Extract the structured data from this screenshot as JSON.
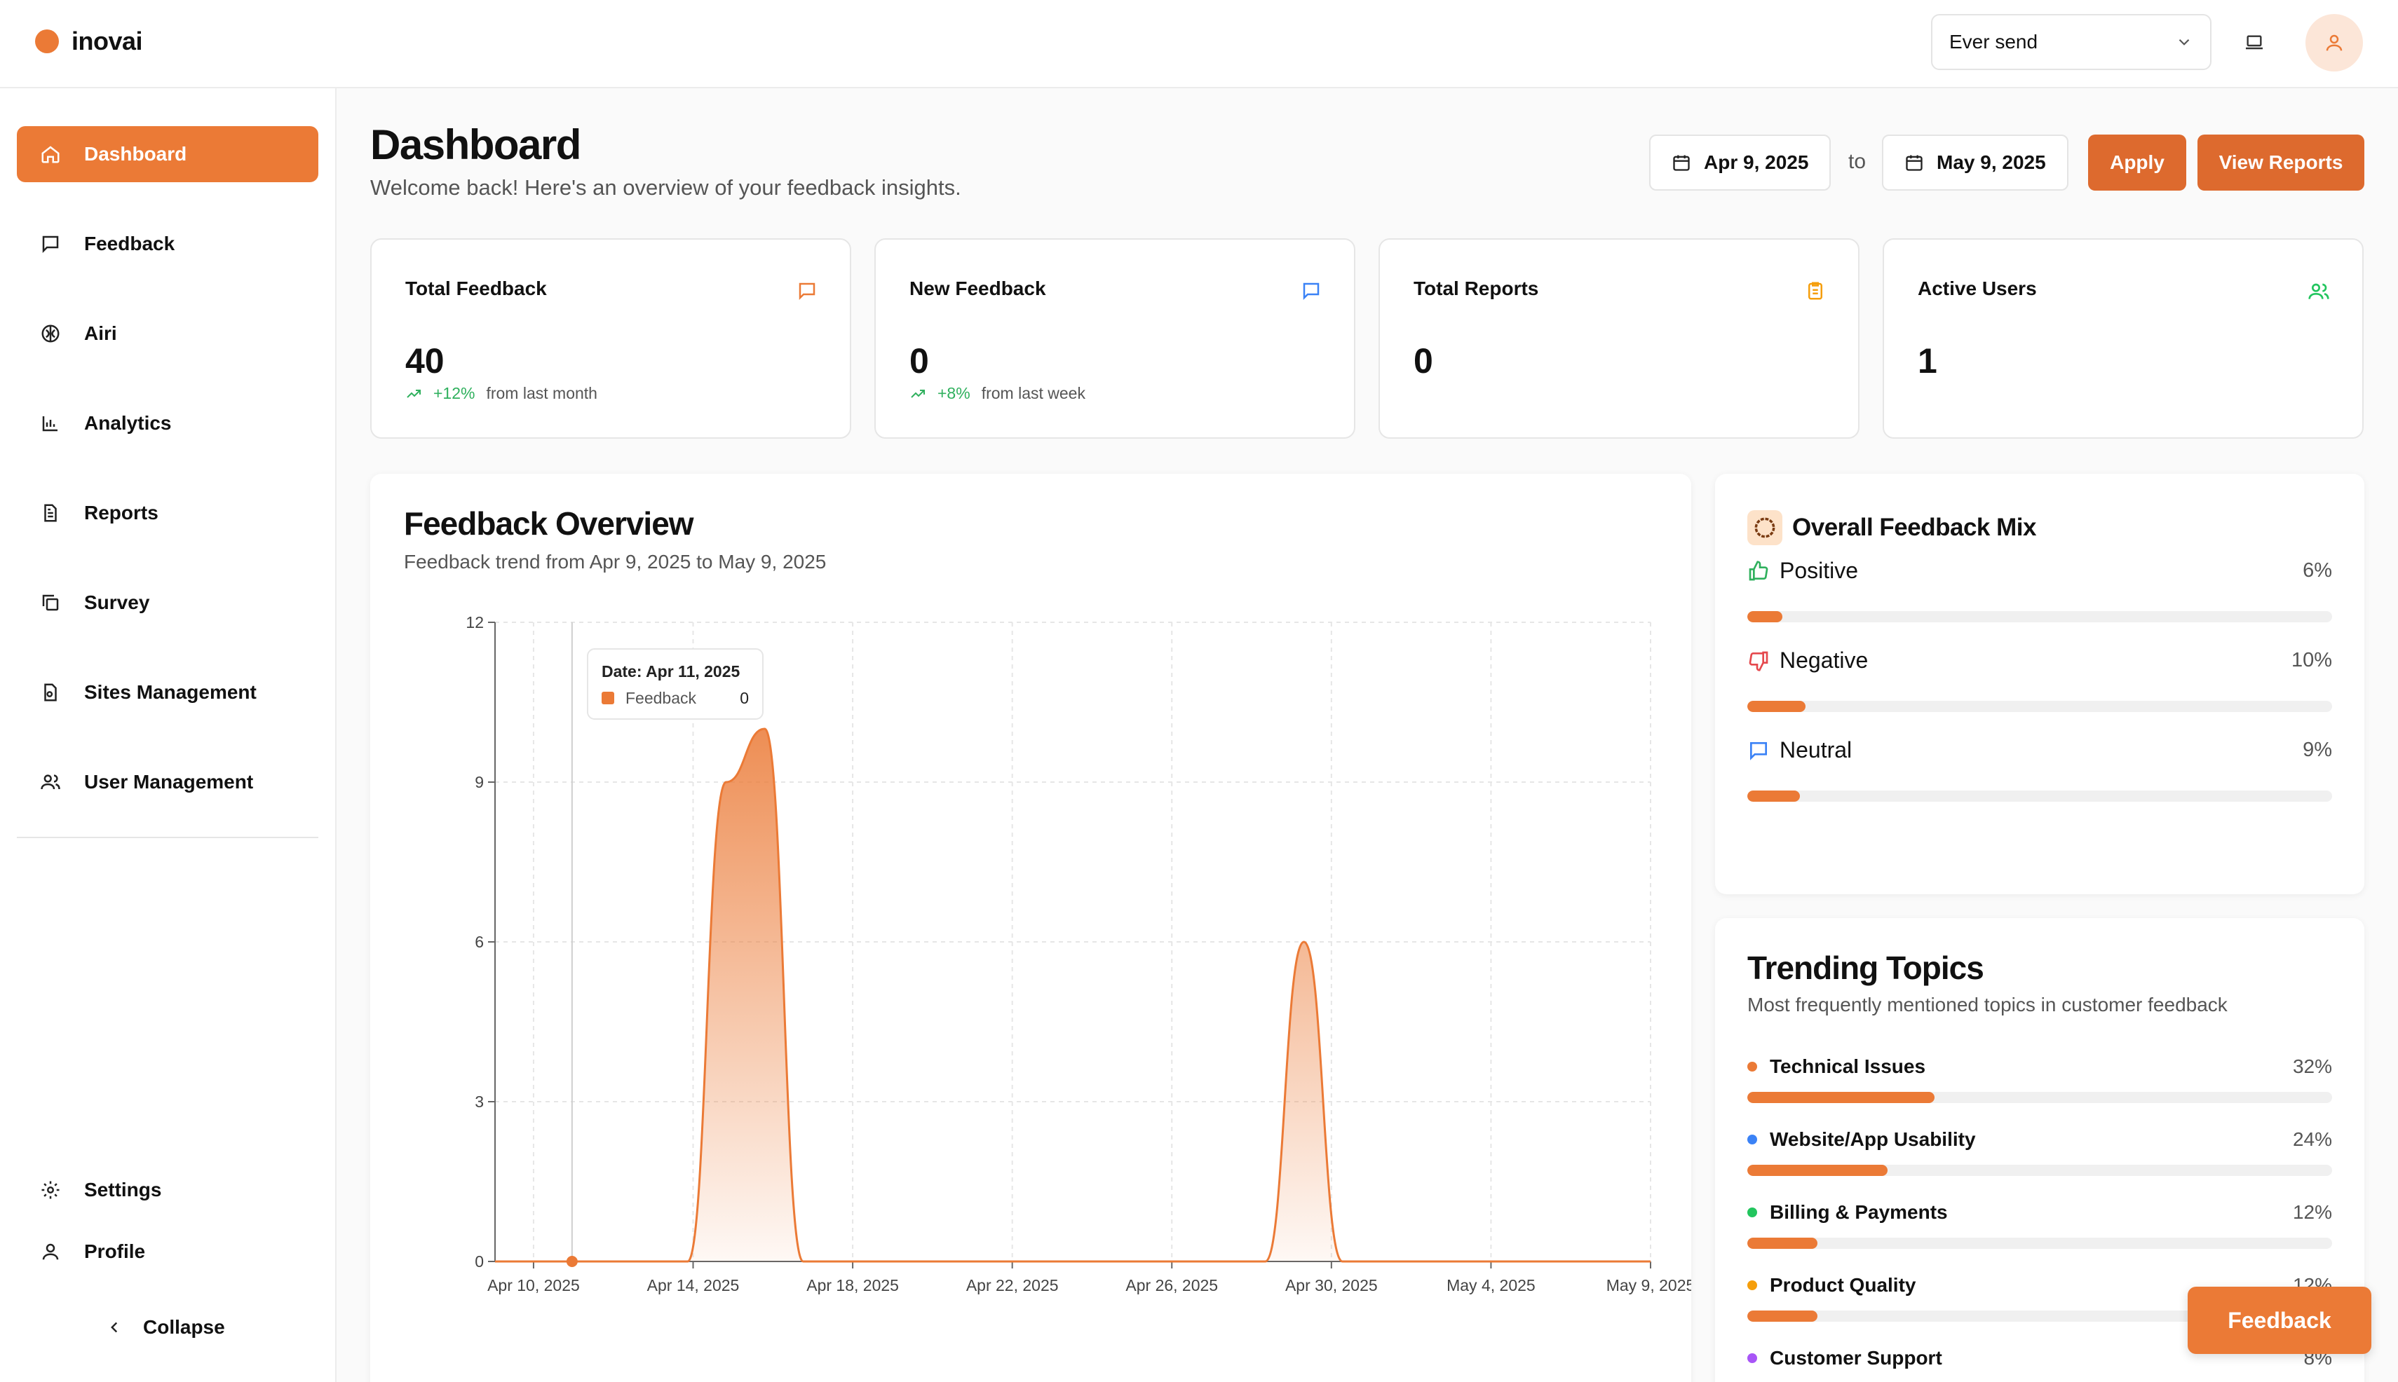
{
  "app": {
    "name": "inovai"
  },
  "header": {
    "workspace_value": "Ever send"
  },
  "sidebar": {
    "items": [
      {
        "label": "Dashboard"
      },
      {
        "label": "Feedback"
      },
      {
        "label": "Airi"
      },
      {
        "label": "Analytics"
      },
      {
        "label": "Reports"
      },
      {
        "label": "Survey"
      },
      {
        "label": "Sites Management"
      },
      {
        "label": "User Management"
      }
    ],
    "bottom": [
      {
        "label": "Settings"
      },
      {
        "label": "Profile"
      }
    ],
    "collapse_label": "Collapse"
  },
  "page": {
    "title": "Dashboard",
    "subtitle": "Welcome back! Here's an overview of your feedback insights.",
    "date_from": "Apr 9, 2025",
    "to_label": "to",
    "date_to": "May 9, 2025",
    "apply_label": "Apply",
    "view_reports_label": "View Reports"
  },
  "stats": [
    {
      "title": "Total Feedback",
      "value": "40",
      "change": "+12%",
      "change_note": "from last month"
    },
    {
      "title": "New Feedback",
      "value": "0",
      "change": "+8%",
      "change_note": "from last week"
    },
    {
      "title": "Total Reports",
      "value": "0"
    },
    {
      "title": "Active Users",
      "value": "1"
    }
  ],
  "overview": {
    "title": "Feedback Overview",
    "subtitle": "Feedback trend from Apr 9, 2025 to May 9, 2025",
    "tooltip": {
      "date": "Date: Apr 11, 2025",
      "series": "Feedback",
      "value": "0"
    }
  },
  "chart_data": {
    "type": "area",
    "title": "Feedback Overview",
    "x_tick_labels": [
      "Apr 10, 2025",
      "Apr 14, 2025",
      "Apr 18, 2025",
      "Apr 22, 2025",
      "Apr 26, 2025",
      "Apr 30, 2025",
      "May 4, 2025",
      "May 9, 2025"
    ],
    "y_ticks": [
      0,
      3,
      6,
      9,
      12
    ],
    "ylim": [
      0,
      12
    ],
    "grid": true,
    "series": [
      {
        "name": "Feedback",
        "color": "#eb7a36",
        "x": [
          "2025-04-09",
          "2025-04-10",
          "2025-04-11",
          "2025-04-12",
          "2025-04-13",
          "2025-04-14",
          "2025-04-15",
          "2025-04-16",
          "2025-04-17",
          "2025-04-18",
          "2025-04-19",
          "2025-04-20",
          "2025-04-21",
          "2025-04-22",
          "2025-04-23",
          "2025-04-24",
          "2025-04-25",
          "2025-04-26",
          "2025-04-27",
          "2025-04-28",
          "2025-04-29",
          "2025-04-30",
          "2025-05-01",
          "2025-05-02",
          "2025-05-03",
          "2025-05-04",
          "2025-05-05",
          "2025-05-06",
          "2025-05-07",
          "2025-05-08",
          "2025-05-09"
        ],
        "values": [
          0,
          0,
          0,
          0,
          0,
          0,
          9,
          10,
          0,
          0,
          0,
          0,
          0,
          0,
          0,
          0,
          0,
          0,
          0,
          0,
          0,
          6,
          0,
          0,
          0,
          0,
          0,
          0,
          0,
          0,
          0
        ]
      }
    ]
  },
  "mix": {
    "title": "Overall Feedback Mix",
    "items": [
      {
        "label": "Positive",
        "pct": "6%",
        "value": 6
      },
      {
        "label": "Negative",
        "pct": "10%",
        "value": 10
      },
      {
        "label": "Neutral",
        "pct": "9%",
        "value": 9
      }
    ],
    "bar_color": "#eb7a36"
  },
  "trending": {
    "title": "Trending Topics",
    "subtitle": "Most frequently mentioned topics in customer feedback",
    "items": [
      {
        "label": "Technical Issues",
        "pct": "32%",
        "value": 32,
        "dot": "#eb7a36"
      },
      {
        "label": "Website/App Usability",
        "pct": "24%",
        "value": 24,
        "dot": "#3b82f6"
      },
      {
        "label": "Billing & Payments",
        "pct": "12%",
        "value": 12,
        "dot": "#22c55e"
      },
      {
        "label": "Product Quality",
        "pct": "12%",
        "value": 12,
        "dot": "#f59e0b"
      },
      {
        "label": "Customer Support",
        "pct": "8%",
        "value": 8,
        "dot": "#a855f7"
      }
    ]
  },
  "fab_label": "Feedback",
  "colors": {
    "accent": "#eb7a36",
    "accent_dark": "#dd6a2e",
    "positive": "#2fb05d"
  }
}
